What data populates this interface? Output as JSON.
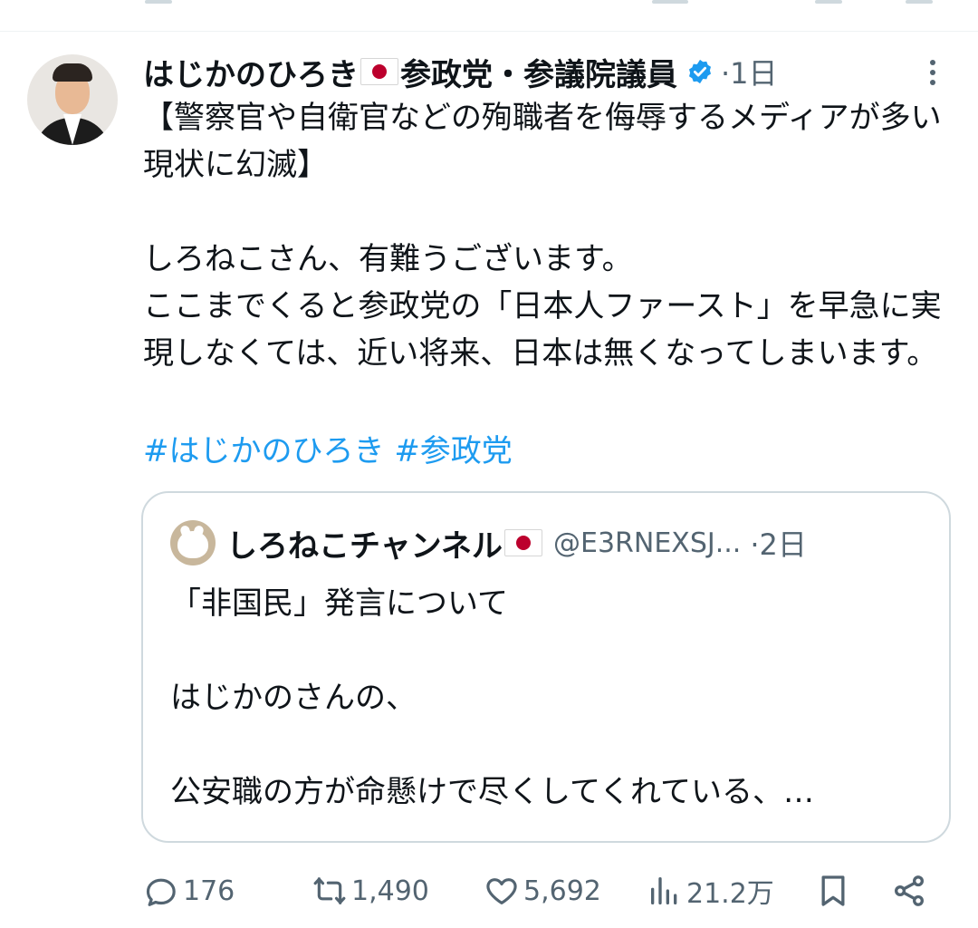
{
  "colors": {
    "accent": "#1d9bf0",
    "text": "#0f1419",
    "secondary": "#536471",
    "border": "#cfd9de"
  },
  "tweet": {
    "display_name": "はじかのひろき",
    "name_suffix": "参政党・参議院議員",
    "time": "·1日",
    "body": "【警察官や自衛官などの殉職者を侮辱するメディアが多い現状に幻滅】\n\nしろねこさん、有難うございます。\nここまでくると参政党の「日本人ファースト」を早急に実現しなくては、近い将来、日本は無くなってしまいます。",
    "hashtags": [
      "#はじかのひろき",
      "#参政党"
    ]
  },
  "quote": {
    "display_name": "しろねこチャンネル",
    "handle": "@E3RNEXSJ...",
    "time": "·2日",
    "text": "「非国民」発言について\n\nはじかのさんの、\n\n公安職の方が命懸けで尽くしてくれている、…"
  },
  "actions": {
    "reply_count": "176",
    "repost_count": "1,490",
    "like_count": "5,692",
    "view_count": "21.2万"
  },
  "icons": {
    "verified": "verified-badge-icon",
    "more": "more-dots-icon",
    "reply": "reply-icon",
    "repost": "repost-icon",
    "like": "heart-icon",
    "views": "views-icon",
    "bookmark": "bookmark-icon",
    "share": "share-icon"
  }
}
